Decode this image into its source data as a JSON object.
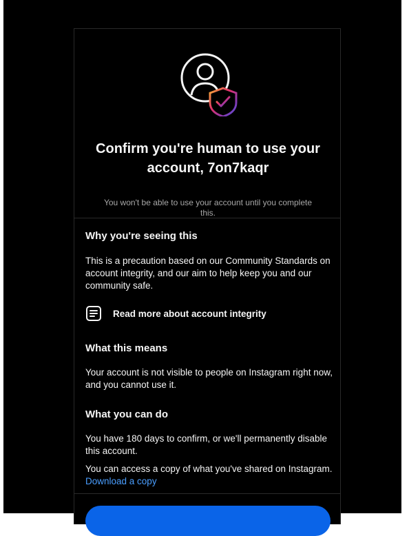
{
  "colors": {
    "card_background": "#000000",
    "text_primary": "#f5f5f5",
    "text_secondary": "#a8a8a8",
    "link": "#4a9eff",
    "button": "#0a64e8",
    "shield_gradient": [
      "#f7b232",
      "#e1306c",
      "#833ab4",
      "#5851db"
    ]
  },
  "header": {
    "icon": "user-shield-icon",
    "title": "Confirm you're human to use your account, 7on7kaqr",
    "subtitle": "You won't be able to use your account until you complete this."
  },
  "why": {
    "heading": "Why you're seeing this",
    "body": "This is a precaution based on our Community Standards on account integrity, and our aim to help keep you and our community safe.",
    "link_icon": "document-icon",
    "link_label": "Read more about account integrity"
  },
  "means": {
    "heading": "What this means",
    "body": "Your account is not visible to people on Instagram right now, and you cannot use it."
  },
  "can_do": {
    "heading": "What you can do",
    "body": "You have 180 days to confirm, or we'll permanently disable this account.",
    "copy_text": "You can access a copy of what you've shared on Instagram.",
    "copy_link": "Download a copy"
  }
}
